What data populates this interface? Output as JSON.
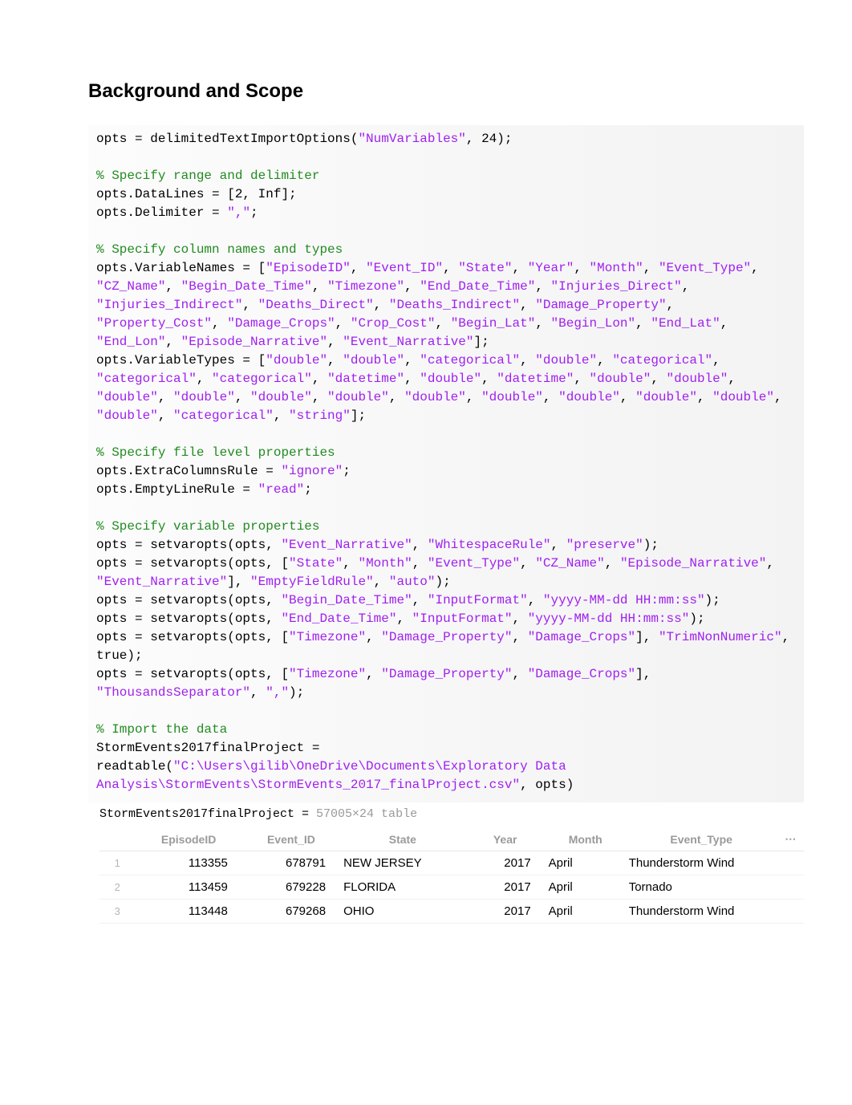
{
  "heading": "Background and Scope",
  "code": {
    "l1a": "opts = delimitedTextImportOptions(",
    "l1s": "\"NumVariables\"",
    "l1b": ", 24);",
    "c1": "% Specify range and delimiter",
    "l2": "opts.DataLines = [2, Inf];",
    "l3a": "opts.Delimiter = ",
    "l3s": "\",\"",
    "l3b": ";",
    "c2": "% Specify column names and types",
    "vn_pre": "opts.VariableNames = [",
    "vn": [
      "\"EpisodeID\"",
      "\"Event_ID\"",
      "\"State\"",
      "\"Year\"",
      "\"Month\"",
      "\"Event_Type\"",
      "\"CZ_Name\"",
      "\"Begin_Date_Time\"",
      "\"Timezone\"",
      "\"End_Date_Time\"",
      "\"Injuries_Direct\"",
      "\"Injuries_Indirect\"",
      "\"Deaths_Direct\"",
      "\"Deaths_Indirect\"",
      "\"Damage_Property\"",
      "\"Property_Cost\"",
      "\"Damage_Crops\"",
      "\"Crop_Cost\"",
      "\"Begin_Lat\"",
      "\"Begin_Lon\"",
      "\"End_Lat\"",
      "\"End_Lon\"",
      "\"Episode_Narrative\"",
      "\"Event_Narrative\""
    ],
    "vt_pre": "opts.VariableTypes = [",
    "vt": [
      "\"double\"",
      "\"double\"",
      "\"categorical\"",
      "\"double\"",
      "\"categorical\"",
      "\"categorical\"",
      "\"categorical\"",
      "\"datetime\"",
      "\"double\"",
      "\"datetime\"",
      "\"double\"",
      "\"double\"",
      "\"double\"",
      "\"double\"",
      "\"double\"",
      "\"double\"",
      "\"double\"",
      "\"double\"",
      "\"double\"",
      "\"double\"",
      "\"double\"",
      "\"double\"",
      "\"categorical\"",
      "\"string\""
    ],
    "c3": "% Specify file level properties",
    "l4a": "opts.ExtraColumnsRule = ",
    "l4s": "\"ignore\"",
    "l5a": "opts.EmptyLineRule = ",
    "l5s": "\"read\"",
    "c4": "% Specify variable properties",
    "sv1_pre": "opts = setvaropts(opts, ",
    "sv1": [
      "\"Event_Narrative\"",
      "\"WhitespaceRule\"",
      "\"preserve\""
    ],
    "sv2_pre": "opts = setvaropts(opts, [",
    "sv2_list": [
      "\"State\"",
      "\"Month\"",
      "\"Event_Type\"",
      "\"CZ_Name\"",
      "\"Episode_Narrative\"",
      "\"Event_Narrative\""
    ],
    "sv2_post": [
      "\"EmptyFieldRule\"",
      "\"auto\""
    ],
    "sv3": [
      "\"Begin_Date_Time\"",
      "\"InputFormat\"",
      "\"yyyy-MM-dd HH:mm:ss\""
    ],
    "sv4": [
      "\"End_Date_Time\"",
      "\"InputFormat\"",
      "\"yyyy-MM-dd HH:mm:ss\""
    ],
    "sv5_list": [
      "\"Timezone\"",
      "\"Damage_Property\"",
      "\"Damage_Crops\""
    ],
    "sv5_post": "\"TrimNonNumeric\"",
    "sv5_true": ", true);",
    "sv6_post": [
      "\"ThousandsSeparator\"",
      "\",\""
    ],
    "c5": "% Import the data",
    "imp1": "StormEvents2017finalProject =",
    "imp2a": "readtable(",
    "imp2s": "\"C:\\Users\\gilib\\OneDrive\\Documents\\Exploratory Data Analysis\\StormEvents\\StormEvents_2017_finalProject.csv\"",
    "imp2b": ", opts)"
  },
  "output": {
    "varname": "StormEvents2017finalProject = ",
    "dims": "57005×24 table",
    "headers": [
      "EpisodeID",
      "Event_ID",
      "State",
      "Year",
      "Month",
      "Event_Type"
    ],
    "ellipsis": "⋯",
    "rows": [
      {
        "n": "1",
        "EpisodeID": "113355",
        "Event_ID": "678791",
        "State": "NEW JERSEY",
        "Year": "2017",
        "Month": "April",
        "Event_Type": "Thunderstorm Wind"
      },
      {
        "n": "2",
        "EpisodeID": "113459",
        "Event_ID": "679228",
        "State": "FLORIDA",
        "Year": "2017",
        "Month": "April",
        "Event_Type": "Tornado"
      },
      {
        "n": "3",
        "EpisodeID": "113448",
        "Event_ID": "679268",
        "State": "OHIO",
        "Year": "2017",
        "Month": "April",
        "Event_Type": "Thunderstorm Wind"
      }
    ]
  }
}
